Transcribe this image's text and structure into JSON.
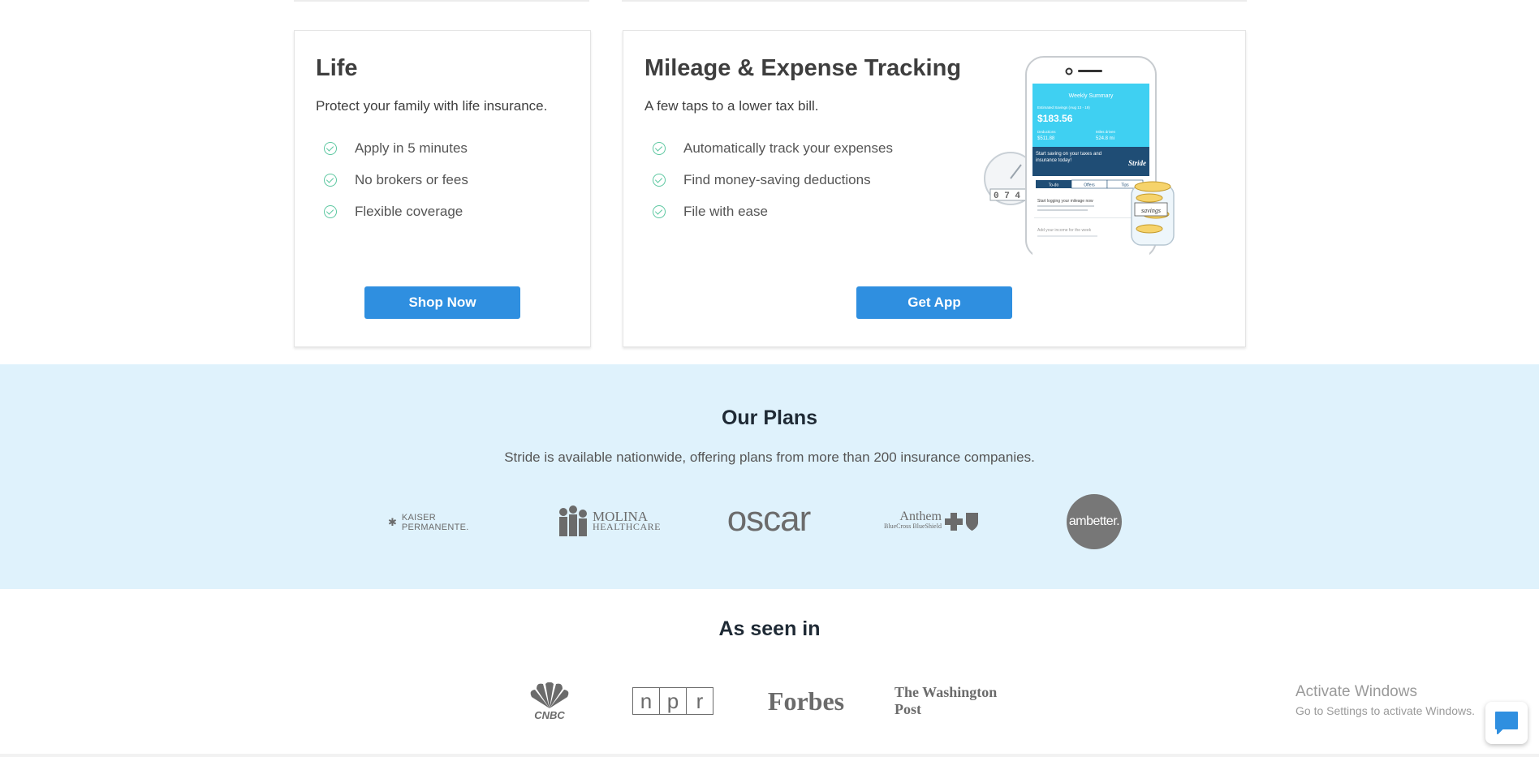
{
  "life_card": {
    "title": "Life",
    "subtitle": "Protect your family with life insurance.",
    "features": [
      "Apply in 5 minutes",
      "No brokers or fees",
      "Flexible coverage"
    ],
    "button_label": "Shop Now"
  },
  "mileage_card": {
    "title": "Mileage & Expense Tracking",
    "subtitle": "A few taps to a lower tax bill.",
    "features": [
      "Automatically track your expenses",
      "Find money-saving deductions",
      "File with ease"
    ],
    "button_label": "Get App",
    "phone": {
      "screen_title": "Weekly Summary",
      "savings_label": "Estimated Savings (Aug 13 - 19)",
      "savings_value": "$183.56",
      "deductions_label": "Deductions",
      "deductions_value": "$511.88",
      "miles_label": "Miles driven",
      "miles_value": "524.8 mi",
      "banner_text": "Start saving on your taxes and insurance today!",
      "brand": "Stride",
      "tabs": [
        "To-do",
        "Offers",
        "Tips"
      ],
      "item1_title": "Start logging your mileage now",
      "item2_title": "Add your income for the week",
      "odometer": "0 7 4 5",
      "jar_label": "savings"
    }
  },
  "plans": {
    "title": "Our Plans",
    "description": "Stride is available nationwide, offering plans from more than 200 insurance companies.",
    "logos": {
      "kaiser": "KAISER PERMANENTE.",
      "molina_1": "MOLINA",
      "molina_2": "HEALTHCARE",
      "oscar": "oscar",
      "anthem_1": "Anthem",
      "anthem_2": "BlueCross BlueShield",
      "ambetter": "ambetter."
    }
  },
  "as_seen_in": {
    "title": "As seen in",
    "logos": {
      "cnbc": "CNBC",
      "npr": [
        "n",
        "p",
        "r"
      ],
      "forbes": "Forbes",
      "wapo": "The Washington Post"
    }
  },
  "windows_watermark": {
    "line1": "Activate Windows",
    "line2": "Go to Settings to activate Windows."
  },
  "colors": {
    "button": "#2f8fe0",
    "plans_bg": "#dff2fc",
    "check": "#5cc7a0"
  },
  "icons": {
    "check": "check-circle-icon",
    "chat": "chat-bubble-icon"
  }
}
